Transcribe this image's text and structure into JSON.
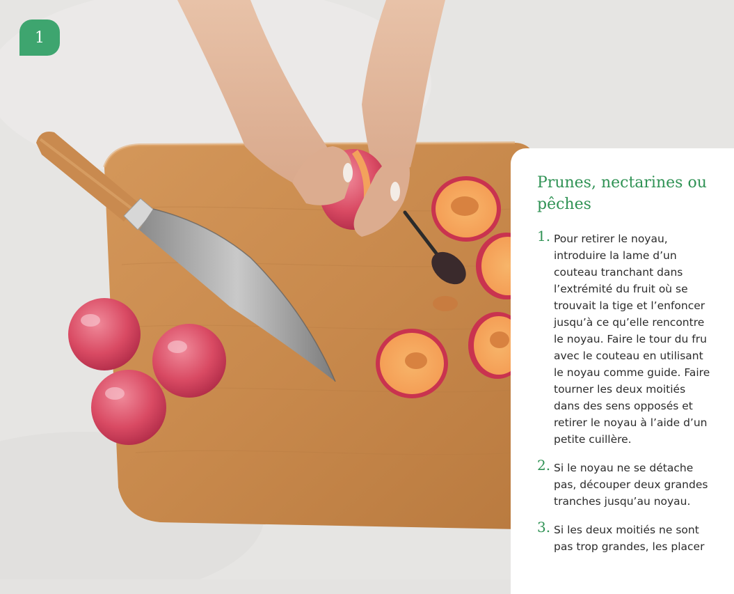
{
  "step_badge": "1",
  "panel": {
    "title": "Prunes, nectarines ou pêches",
    "steps": [
      {
        "number": "1.",
        "lines": [
          "Pour retirer le noyau,",
          "introduire la lame d’un",
          "couteau tranchant dans",
          "l’extrémité du fruit où se",
          "trouvait la tige et l’enfoncer",
          "jusqu’à ce qu’elle rencontre",
          "le noyau. Faire le tour du fru",
          "avec le couteau en utilisant",
          "le noyau comme guide. Faire",
          "tourner les deux moitiés",
          "dans des sens opposés et",
          "retirer le noyau à l’aide d’un",
          "petite cuillère."
        ]
      },
      {
        "number": "2.",
        "lines": [
          "Si le noyau ne se détache",
          "pas, découper deux grandes",
          "tranches jusqu’au noyau."
        ]
      },
      {
        "number": "3.",
        "lines": [
          "Si les deux moitiés ne sont",
          "pas trop grandes, les placer"
        ]
      }
    ]
  },
  "colors": {
    "accent_green": "#3ea56f",
    "title_green": "#2f9254",
    "board": "#c8894c",
    "countertop": "#e4e3e1"
  }
}
